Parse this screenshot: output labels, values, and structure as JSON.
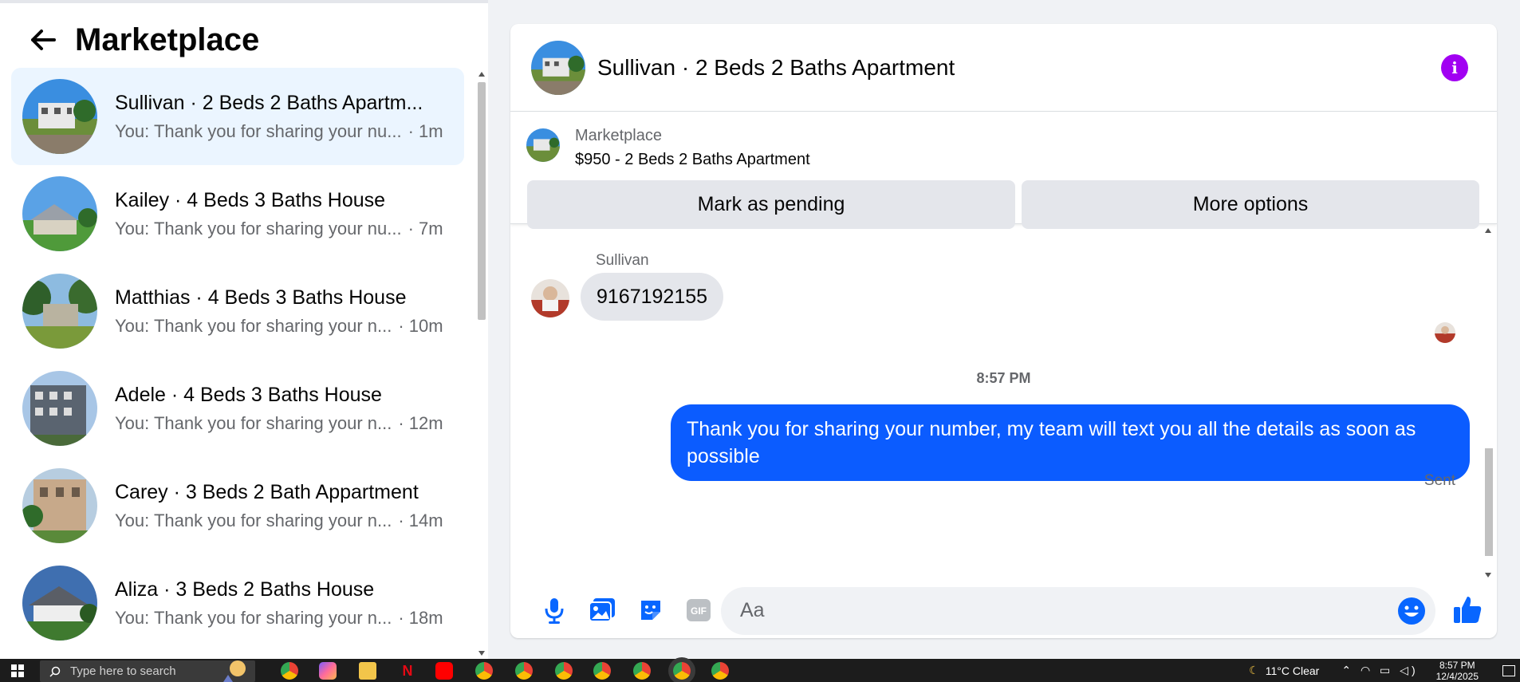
{
  "left_panel": {
    "title": "Marketplace",
    "conversations": [
      {
        "name": "Sullivan · 2 Beds 2 Baths Apartm...",
        "preview": "You: Thank you for sharing your nu...",
        "time": "· 1m",
        "active": true
      },
      {
        "name": "Kailey · 4 Beds 3 Baths House",
        "preview": "You: Thank you for sharing your nu...",
        "time": "· 7m",
        "active": false
      },
      {
        "name": "Matthias · 4 Beds 3 Baths House",
        "preview": "You: Thank you for sharing your n...",
        "time": "· 10m",
        "active": false
      },
      {
        "name": "Adele · 4 Beds 3 Baths House",
        "preview": "You: Thank you for sharing your n...",
        "time": "· 12m",
        "active": false
      },
      {
        "name": "Carey · 3 Beds 2 Bath Appartment",
        "preview": "You: Thank you for sharing your n...",
        "time": "· 14m",
        "active": false
      },
      {
        "name": "Aliza · 3 Beds 2 Baths House",
        "preview": "You: Thank you for sharing your n...",
        "time": "· 18m",
        "active": false
      }
    ]
  },
  "chat": {
    "title": "Sullivan · 2 Beds 2 Baths Apartment",
    "marketplace_label": "Marketplace",
    "listing": "$950 - 2 Beds 2 Baths Apartment",
    "mark_pending": "Mark as pending",
    "more_options": "More options",
    "sender_name": "Sullivan",
    "incoming_message": "9167192155",
    "time_separator": "8:57 PM",
    "outgoing_message": "Thank you for  sharing your number, my team will text you all the details as soon as possible",
    "sent_label": "Sent",
    "composer_placeholder": "Aa"
  },
  "taskbar": {
    "search_placeholder": "Type here to search",
    "weather": "11°C  Clear",
    "time": "8:57 PM",
    "date": "12/4/2025"
  },
  "colors": {
    "accent_blue": "#0b5cff",
    "icon_blue": "#0866ff",
    "info_purple": "#a100f2",
    "active_row": "#ebf5ff"
  }
}
